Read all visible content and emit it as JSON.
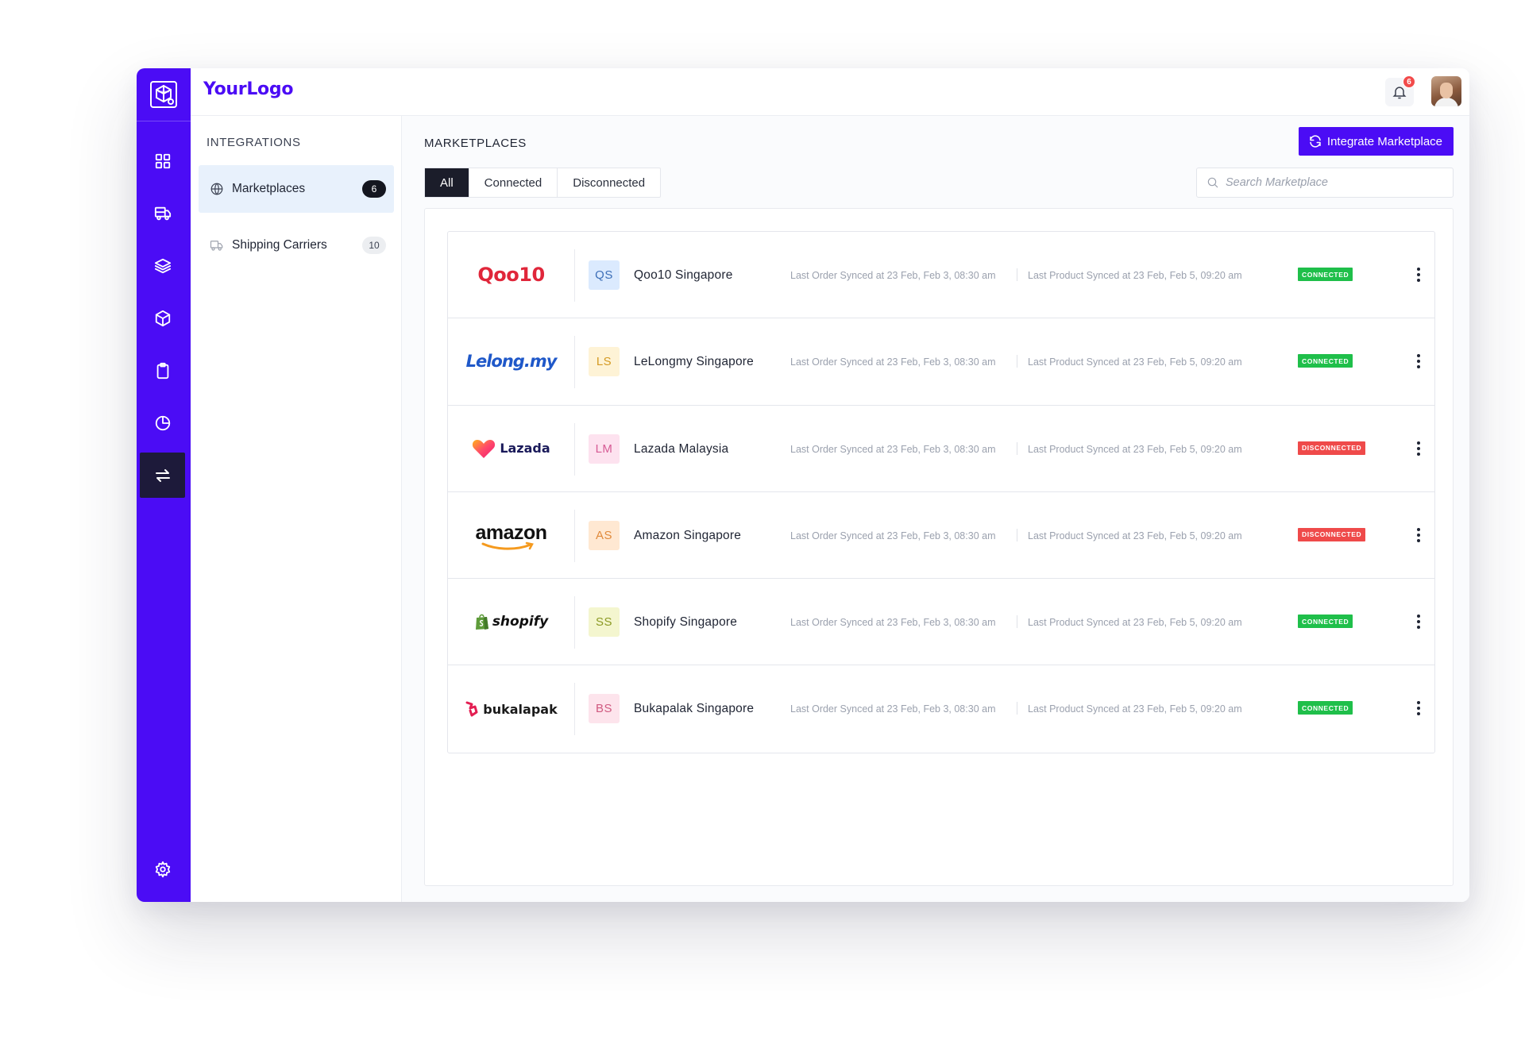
{
  "header": {
    "brand": "YourLogo",
    "notification_count": "6"
  },
  "rail": {
    "icons": [
      "dashboard-icon",
      "truck-icon",
      "layers-icon",
      "box-icon",
      "clipboard-icon",
      "pie-chart-icon",
      "sync-arrows-icon",
      "gear-icon"
    ],
    "active": "sync-arrows-icon"
  },
  "subnav": {
    "title": "INTEGRATIONS",
    "items": [
      {
        "label": "Marketplaces",
        "count": "6",
        "icon": "globe-icon",
        "active": true
      },
      {
        "label": "Shipping Carriers",
        "count": "10",
        "icon": "truck-icon",
        "active": false
      }
    ]
  },
  "main": {
    "title": "MARKETPLACES",
    "integrate_button": "Integrate Marketplace",
    "tabs": [
      {
        "label": "All",
        "active": true
      },
      {
        "label": "Connected",
        "active": false
      },
      {
        "label": "Disconnected",
        "active": false
      }
    ],
    "search_placeholder": "Search Marketplace",
    "marketplaces": [
      {
        "logo": "Qoo10",
        "initials": "QS",
        "name": "Qoo10 Singapore",
        "order_sync": "Last Order Synced at 23 Feb, Feb 3, 08:30 am",
        "product_sync": "Last Product Synced at 23 Feb, Feb 5, 09:20 am",
        "status": "CONNECTED"
      },
      {
        "logo": "Lelong.my",
        "initials": "LS",
        "name": "LeLongmy Singapore",
        "order_sync": "Last Order Synced at 23 Feb, Feb 3, 08:30 am",
        "product_sync": "Last Product Synced at 23 Feb, Feb 5, 09:20 am",
        "status": "CONNECTED"
      },
      {
        "logo": "Lazada",
        "initials": "LM",
        "name": "Lazada Malaysia",
        "order_sync": "Last Order Synced at 23 Feb, Feb 3, 08:30 am",
        "product_sync": "Last Product Synced at 23 Feb, Feb 5, 09:20 am",
        "status": "DISCONNECTED"
      },
      {
        "logo": "amazon",
        "initials": "AS",
        "name": "Amazon Singapore",
        "order_sync": "Last Order Synced at 23 Feb, Feb 3, 08:30 am",
        "product_sync": "Last Product Synced at 23 Feb, Feb 5, 09:20 am",
        "status": "DISCONNECTED"
      },
      {
        "logo": "shopify",
        "initials": "SS",
        "name": "Shopify Singapore",
        "order_sync": "Last Order Synced at 23 Feb, Feb 3, 08:30 am",
        "product_sync": "Last Product Synced at 23 Feb, Feb 5, 09:20 am",
        "status": "CONNECTED"
      },
      {
        "logo": "bukalapak",
        "initials": "BS",
        "name": "Bukapalak Singapore",
        "order_sync": "Last Order Synced at 23 Feb, Feb 3, 08:30 am",
        "product_sync": "Last Product Synced at 23 Feb, Feb 5, 09:20 am",
        "status": "CONNECTED"
      }
    ]
  },
  "colors": {
    "brand": "#4b0cf5",
    "connected": "#1fbf4a",
    "disconnected": "#ef4a4a",
    "initials_bg": [
      "#dbeafe",
      "#fef3d6",
      "#fde2ef",
      "#ffe8d2",
      "#f4f6cf",
      "#fde4ec"
    ],
    "initials_fg": [
      "#3d6fb8",
      "#d49a22",
      "#d65b95",
      "#e08a3c",
      "#8c9a24",
      "#d05a80"
    ]
  }
}
